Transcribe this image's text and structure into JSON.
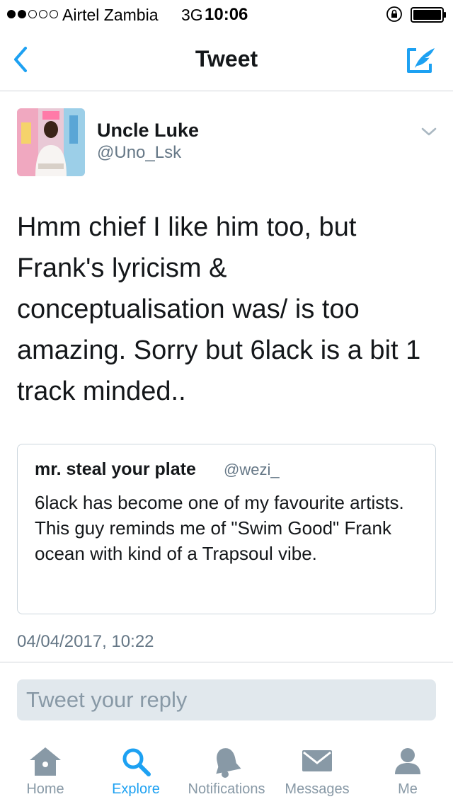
{
  "status_bar": {
    "carrier": "Airtel Zambia",
    "network": "3G",
    "time": "10:06",
    "signal_bars_filled": 2,
    "signal_bars_total": 5
  },
  "header": {
    "title": "Tweet",
    "back_icon": "chevron-left-icon",
    "compose_icon": "compose-tweet-icon",
    "accent_color": "#1da1f2"
  },
  "tweet": {
    "author_name": "Uncle Luke",
    "author_handle": "@Uno_Lsk",
    "text": "Hmm chief I like him too, but Frank's lyricism & conceptualisation was/ is too amazing. Sorry but 6lack is a bit 1 track minded..",
    "timestamp": "04/04/2017, 10:22"
  },
  "quoted_tweet": {
    "author_name": "mr. steal your plate",
    "author_handle": "@wezi_",
    "text": "6lack has become one of my favourite artists. This guy reminds me of \"Swim Good\" Frank ocean with kind of a Trapsoul vibe."
  },
  "reply": {
    "placeholder": "Tweet your reply"
  },
  "tabs": [
    {
      "label": "Home",
      "icon": "home-icon",
      "active": false
    },
    {
      "label": "Explore",
      "icon": "search-icon",
      "active": true
    },
    {
      "label": "Notifications",
      "icon": "bell-icon",
      "active": false
    },
    {
      "label": "Messages",
      "icon": "envelope-icon",
      "active": false
    },
    {
      "label": "Me",
      "icon": "person-icon",
      "active": false
    }
  ]
}
